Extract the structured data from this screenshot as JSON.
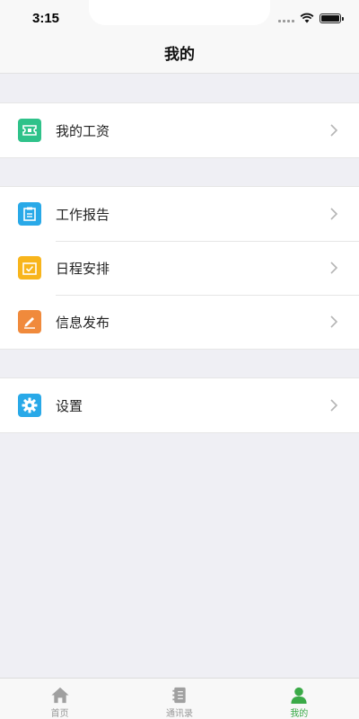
{
  "status_bar": {
    "time": "3:15"
  },
  "nav": {
    "title": "我的"
  },
  "groups": [
    {
      "items": [
        {
          "label": "我的工资",
          "icon": "salary-icon",
          "color": "#2fc28a"
        }
      ]
    },
    {
      "items": [
        {
          "label": "工作报告",
          "icon": "report-icon",
          "color": "#29a9e8"
        },
        {
          "label": "日程安排",
          "icon": "schedule-icon",
          "color": "#f8b51c"
        },
        {
          "label": "信息发布",
          "icon": "publish-icon",
          "color": "#f08a3c"
        }
      ]
    },
    {
      "items": [
        {
          "label": "设置",
          "icon": "settings-icon",
          "color": "#29a9e8"
        }
      ]
    }
  ],
  "tabs": [
    {
      "label": "首页",
      "icon": "home-icon",
      "active": false
    },
    {
      "label": "通讯录",
      "icon": "contacts-icon",
      "active": false
    },
    {
      "label": "我的",
      "icon": "profile-icon",
      "active": true
    }
  ],
  "colors": {
    "active_tab": "#3aaa47",
    "inactive_tab": "#999999",
    "background": "#efeff4"
  }
}
